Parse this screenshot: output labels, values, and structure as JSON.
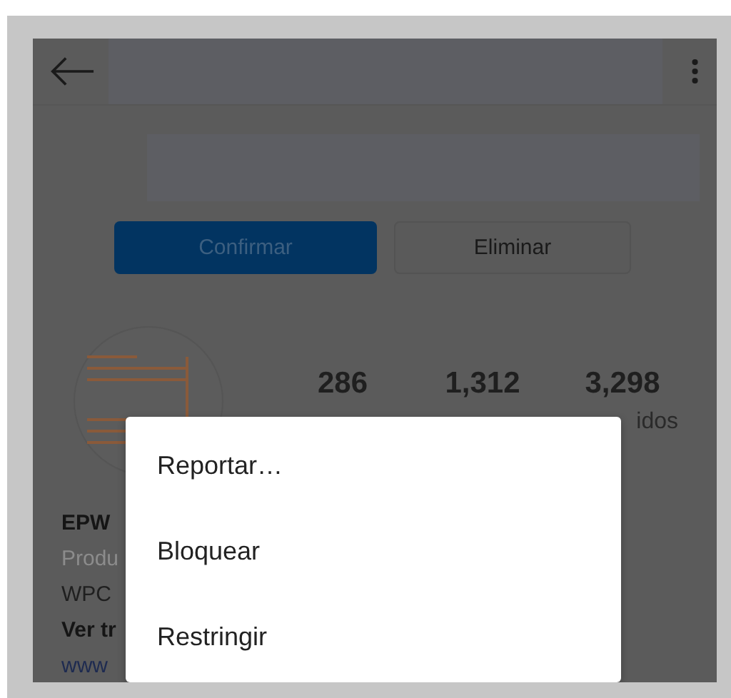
{
  "top_bar": {
    "menu_open": true
  },
  "buttons": [
    {
      "label": "Confirmar",
      "kind": "primary"
    },
    {
      "label": "Eliminar",
      "kind": "secondary"
    }
  ],
  "stats": [
    {
      "value": "286"
    },
    {
      "value": "1,312"
    },
    {
      "value": "3,298",
      "label": "idos"
    }
  ],
  "bio": [
    {
      "text": "EPW",
      "kind": "name"
    },
    {
      "text": "Produ",
      "kind": "category"
    },
    {
      "text": "WPC",
      "kind": "plain"
    },
    {
      "text": "Ver tr",
      "kind": "bold"
    },
    {
      "text": "www",
      "kind": "link"
    }
  ],
  "menu": {
    "items": [
      "Reportar…",
      "Bloquear",
      "Restringir"
    ]
  }
}
